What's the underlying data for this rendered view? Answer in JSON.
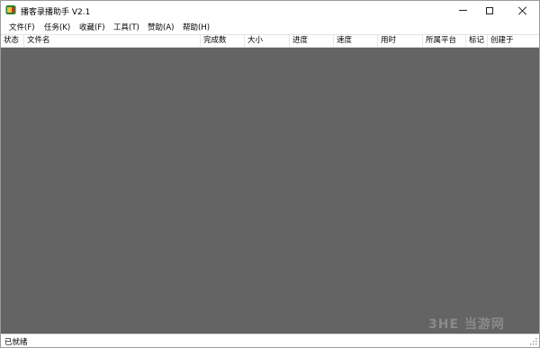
{
  "window": {
    "title": "播客录播助手 V2.1",
    "icon": "app-icon",
    "controls": {
      "minimize": "minimize-icon",
      "maximize": "maximize-icon",
      "close": "close-icon"
    }
  },
  "menubar": {
    "items": [
      {
        "label": "文件(F)"
      },
      {
        "label": "任务(K)"
      },
      {
        "label": "收藏(F)"
      },
      {
        "label": "工具(T)"
      },
      {
        "label": "赞助(A)"
      },
      {
        "label": "帮助(H)"
      }
    ]
  },
  "table": {
    "columns": [
      "状态",
      "文件名",
      "完成数",
      "大小",
      "进度",
      "速度",
      "用时",
      "所属平台",
      "标记",
      "创建于"
    ],
    "rows": []
  },
  "status": {
    "text": "已就绪"
  },
  "watermark": {
    "text": "3HE 当游网"
  },
  "colors": {
    "content_bg": "#646464",
    "window_bg": "#ffffff"
  }
}
